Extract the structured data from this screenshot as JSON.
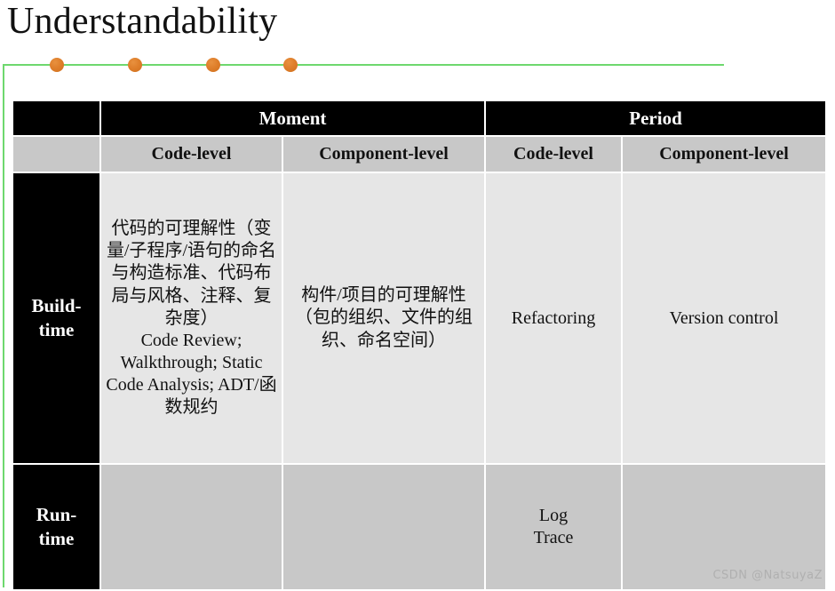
{
  "slide": {
    "title": "Understandability",
    "watermark": "CSDN @NatsuyaZ",
    "accent_line_color": "#6ed86e",
    "accent_dot_color": "#df7f2b",
    "header_bg": "#000000",
    "subheader_bg": "#c8c8c8",
    "cell_bg_light": "#e6e6e6",
    "cell_bg_dark": "#c8c8c8",
    "dot_positions": [
      64,
      152,
      240,
      327
    ]
  },
  "table": {
    "group_headers": [
      {
        "label": "",
        "span": 1
      },
      {
        "label": "Moment",
        "span": 2
      },
      {
        "label": "Period",
        "span": 2
      }
    ],
    "column_headers": [
      "",
      "Code-level",
      "Component-level",
      "Code-level",
      "Component-level"
    ],
    "rows": [
      {
        "label": "Build-\ntime",
        "label_line1": "Build-",
        "label_line2": "time",
        "cells": [
          {
            "text": "代码的可理解性（变量/子程序/语句的命名与构造标准、代码布局与风格、注释、复杂度）\nCode Review; Walkthrough; Static Code Analysis; ADT/函数规约",
            "lines_cjk": "代码的可理解性（变量/子程序/语句的命名与构造标准、代码布局与风格、注释、复杂度）",
            "lines_latin": "Code Review; Walkthrough; Static Code Analysis; ADT/函数规约"
          },
          {
            "text": "构件/项目的可理解性（包的组织、文件的组织、命名空间）",
            "lines_cjk": "构件/项目的可理解性（包的组织、文件的组织、命名空间）",
            "lines_latin": ""
          },
          {
            "text": "Refactoring",
            "lines_cjk": "",
            "lines_latin": "Refactoring"
          },
          {
            "text": "Version control",
            "lines_cjk": "",
            "lines_latin": "Version control"
          }
        ]
      },
      {
        "label": "Run-\ntime",
        "label_line1": "Run-",
        "label_line2": "time",
        "cells": [
          {
            "text": "",
            "lines_cjk": "",
            "lines_latin": ""
          },
          {
            "text": "",
            "lines_cjk": "",
            "lines_latin": ""
          },
          {
            "text": "Log\nTrace",
            "lines_cjk": "",
            "lines_latin": "Log Trace",
            "line1": "Log",
            "line2": "Trace"
          },
          {
            "text": "",
            "lines_cjk": "",
            "lines_latin": ""
          }
        ]
      }
    ]
  }
}
